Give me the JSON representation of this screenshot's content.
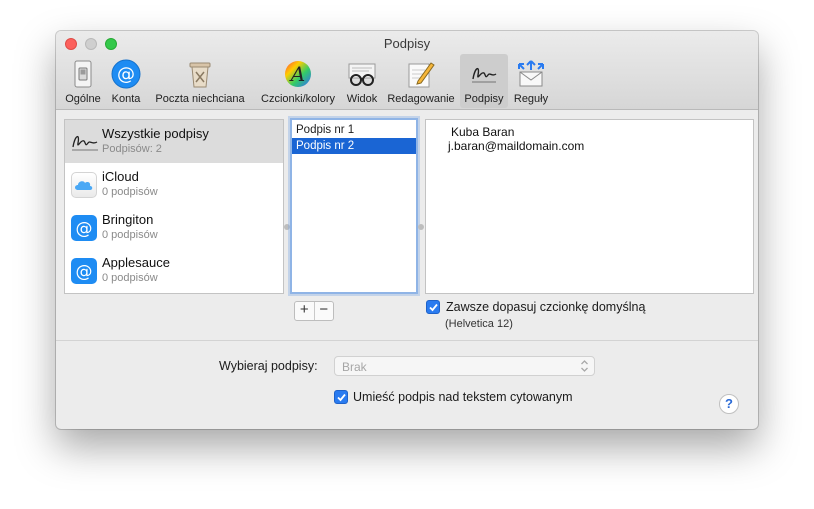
{
  "window": {
    "title": "Podpisy"
  },
  "toolbar": {
    "items": [
      {
        "label": "Ogólne",
        "icon": "general-switch-icon"
      },
      {
        "label": "Konta",
        "icon": "at-sign-icon"
      },
      {
        "label": "Poczta niechciana",
        "icon": "junk-trash-icon"
      },
      {
        "label": "Czcionki/kolory",
        "icon": "font-colors-icon"
      },
      {
        "label": "Widok",
        "icon": "glasses-icon"
      },
      {
        "label": "Redagowanie",
        "icon": "pencil-note-icon"
      },
      {
        "label": "Podpisy",
        "icon": "signature-icon"
      },
      {
        "label": "Reguły",
        "icon": "rules-envelope-icon"
      }
    ],
    "selected": "Podpisy"
  },
  "accounts": [
    {
      "name": "Wszystkie podpisy",
      "count": "Podpisów: 2",
      "icon": "signature-icon"
    },
    {
      "name": "iCloud",
      "count": "0 podpisów",
      "icon": "cloud-icon"
    },
    {
      "name": "Bringiton",
      "count": "0 podpisów",
      "icon": "at-sign-icon"
    },
    {
      "name": "Applesauce",
      "count": "0 podpisów",
      "icon": "at-sign-icon"
    }
  ],
  "signatures": [
    {
      "name": "Podpis nr 1",
      "selected": false
    },
    {
      "name": "Podpis nr 2",
      "selected": true
    }
  ],
  "preview": {
    "line1": "Kuba Baran",
    "line2": "j.baran@maildomain.com"
  },
  "buttons": {
    "add": "+",
    "remove": "−"
  },
  "font_option": {
    "label": "Zawsze dopasuj czcionkę domyślną",
    "sub": "(Helvetica 12)",
    "checked": true
  },
  "choose": {
    "label": "Wybieraj podpisy:",
    "value": "Brak"
  },
  "place_option": {
    "label": "Umieść podpis nad tekstem cytowanym",
    "checked": true
  },
  "help": {
    "label": "?"
  },
  "colors": {
    "selection": "#1a65d4",
    "checkbox": "#2a7bf0",
    "close": "#fc605c",
    "zoom": "#34c84a"
  }
}
